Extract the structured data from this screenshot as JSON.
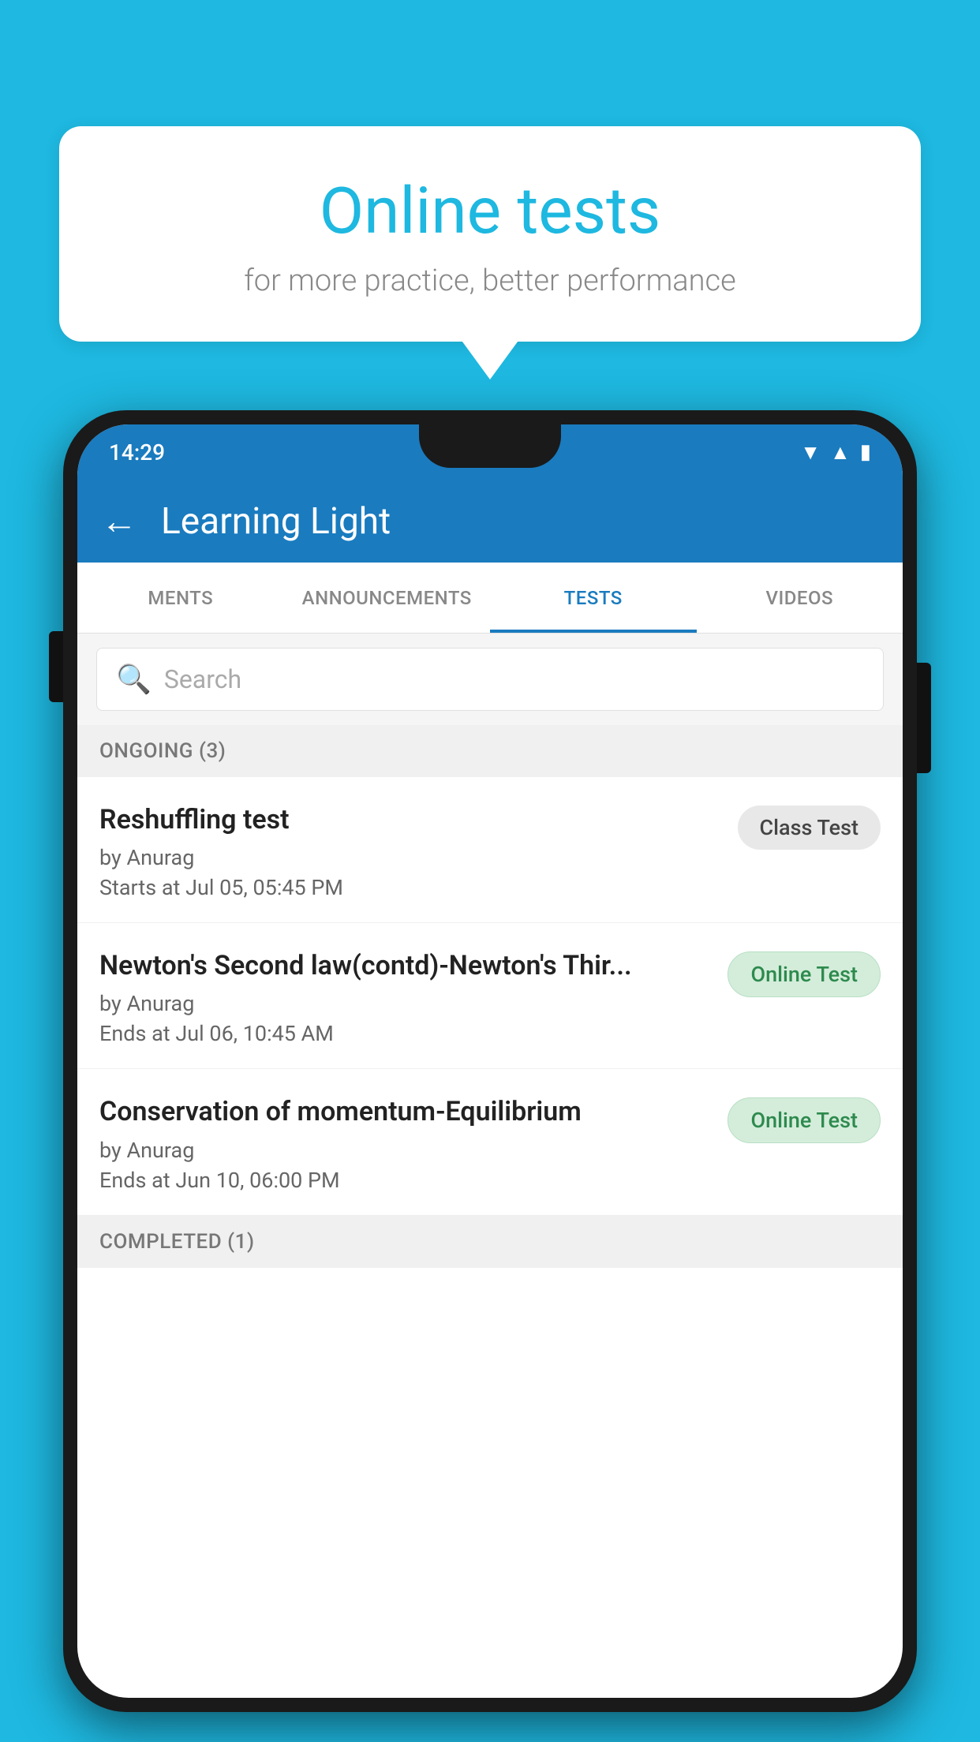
{
  "background_color": "#1eb8e0",
  "speech_bubble": {
    "title": "Online tests",
    "subtitle": "for more practice, better performance"
  },
  "phone": {
    "status_bar": {
      "time": "14:29",
      "icons": [
        "wifi",
        "signal",
        "battery"
      ]
    },
    "app_bar": {
      "title": "Learning Light",
      "back_label": "←"
    },
    "tabs": [
      {
        "label": "MENTS",
        "active": false
      },
      {
        "label": "ANNOUNCEMENTS",
        "active": false
      },
      {
        "label": "TESTS",
        "active": true
      },
      {
        "label": "VIDEOS",
        "active": false
      }
    ],
    "search": {
      "placeholder": "Search",
      "icon": "🔍"
    },
    "ongoing_section": {
      "title": "ONGOING (3)"
    },
    "tests": [
      {
        "name": "Reshuffling test",
        "author": "by Anurag",
        "time_label": "Starts at",
        "time": "Jul 05, 05:45 PM",
        "badge": "Class Test",
        "badge_type": "class"
      },
      {
        "name": "Newton's Second law(contd)-Newton's Thir...",
        "author": "by Anurag",
        "time_label": "Ends at",
        "time": "Jul 06, 10:45 AM",
        "badge": "Online Test",
        "badge_type": "online"
      },
      {
        "name": "Conservation of momentum-Equilibrium",
        "author": "by Anurag",
        "time_label": "Ends at",
        "time": "Jun 10, 06:00 PM",
        "badge": "Online Test",
        "badge_type": "online"
      }
    ],
    "completed_section": {
      "title": "COMPLETED (1)"
    }
  }
}
